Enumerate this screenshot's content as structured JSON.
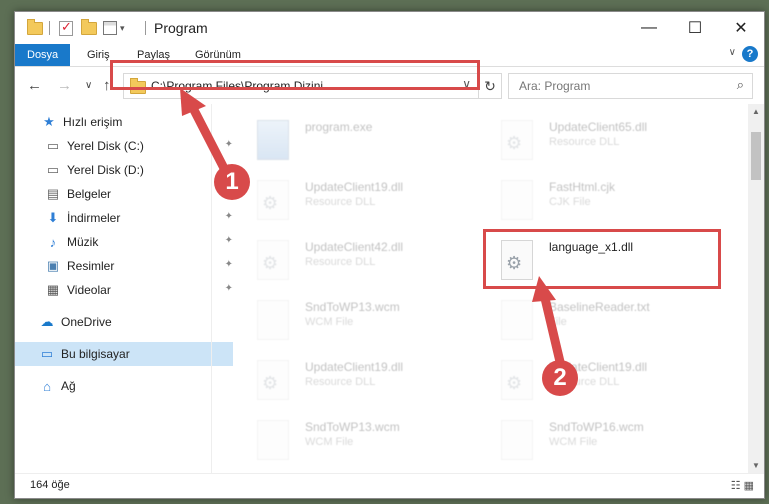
{
  "window": {
    "title": "Program",
    "minimize": "—",
    "maximize": "☐",
    "close": "✕"
  },
  "ribbon": {
    "tabs": [
      "Dosya",
      "Giriş",
      "Paylaş",
      "Görünüm"
    ],
    "expand": "∨",
    "help": "?"
  },
  "nav": {
    "back": "←",
    "forward": "→",
    "recent": "∨",
    "up": "↑"
  },
  "address": {
    "path": "C:\\Program Files\\Program Dizini",
    "dropdown": "∨",
    "refresh": "↻"
  },
  "search": {
    "placeholder": "Ara: Program",
    "icon": "⌕"
  },
  "sidebar": {
    "items": [
      {
        "label": "Hızlı erişim",
        "icon": "★",
        "pinned": false
      },
      {
        "label": "Yerel Disk (C:)",
        "icon": "▭",
        "pinned": true
      },
      {
        "label": "Yerel Disk (D:)",
        "icon": "▭",
        "pinned": true
      },
      {
        "label": "Belgeler",
        "icon": "▤",
        "pinned": true
      },
      {
        "label": "İndirmeler",
        "icon": "⬇",
        "pinned": true
      },
      {
        "label": "Müzik",
        "icon": "♪",
        "pinned": true
      },
      {
        "label": "Resimler",
        "icon": "▣",
        "pinned": true
      },
      {
        "label": "Videolar",
        "icon": "▦",
        "pinned": true
      },
      {
        "label": "OneDrive",
        "icon": "☁",
        "pinned": false
      },
      {
        "label": "Bu bilgisayar",
        "icon": "▭",
        "pinned": false
      },
      {
        "label": "Ağ",
        "icon": "⌂",
        "pinned": false
      }
    ],
    "pin_glyph": "📌"
  },
  "files": {
    "left": [
      {
        "name": "program.exe",
        "type": ""
      },
      {
        "name": "UpdateClient19.dll",
        "type": "Resource DLL"
      },
      {
        "name": "UpdateClient42.dll",
        "type": "Resource DLL"
      },
      {
        "name": "SndToWP13.wcm",
        "type": "WCM File"
      },
      {
        "name": "UpdateClient19.dll",
        "type": "Resource DLL"
      },
      {
        "name": "SndToWP13.wcm",
        "type": "WCM File"
      }
    ],
    "right": [
      {
        "name": "UpdateClient65.dll",
        "type": "Resource DLL"
      },
      {
        "name": "FastHtml.cjk",
        "type": "CJK File"
      },
      {
        "name": "language_x1.dll",
        "type": ""
      },
      {
        "name": "BaselineReader.txt",
        "type": "File"
      },
      {
        "name": "UpdateClient19.dll",
        "type": "Resource DLL"
      },
      {
        "name": "SndToWP16.wcm",
        "type": "WCM File"
      }
    ]
  },
  "status": {
    "count": "164 öğe",
    "views": "☷ ▦"
  },
  "annotations": {
    "step1": "1",
    "step2": "2",
    "color": "#d84a4a"
  }
}
